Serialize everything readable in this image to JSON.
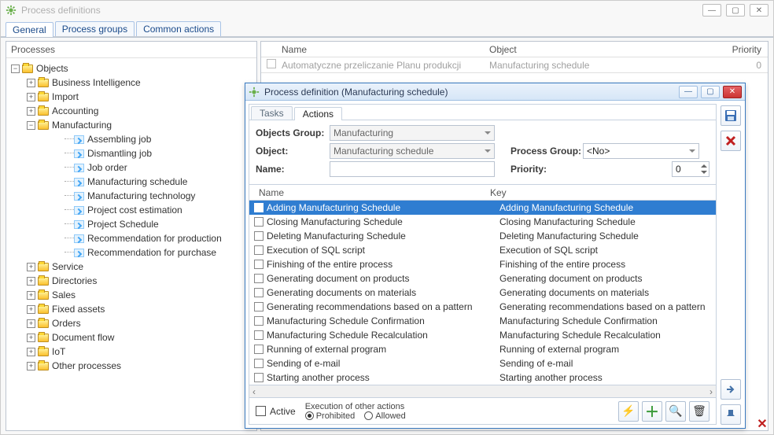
{
  "window": {
    "title": "Process definitions",
    "tabs": [
      "General",
      "Process groups",
      "Common actions"
    ],
    "active_tab": 0
  },
  "tree": {
    "header": "Processes",
    "root": "Objects",
    "folders": [
      {
        "label": "Business Intelligence",
        "expanded": false
      },
      {
        "label": "Import",
        "expanded": false
      },
      {
        "label": "Accounting",
        "expanded": false
      },
      {
        "label": "Manufacturing",
        "expanded": true,
        "children": [
          "Assembling job",
          "Dismantling job",
          "Job order",
          "Manufacturing schedule",
          "Manufacturing technology",
          "Project cost estimation",
          "Project Schedule",
          "Recommendation for production",
          "Recommendation for purchase"
        ]
      },
      {
        "label": "Service",
        "expanded": false
      },
      {
        "label": "Directories",
        "expanded": false
      },
      {
        "label": "Sales",
        "expanded": false
      },
      {
        "label": "Fixed assets",
        "expanded": false
      },
      {
        "label": "Orders",
        "expanded": false
      },
      {
        "label": "Document flow",
        "expanded": false
      },
      {
        "label": "IoT",
        "expanded": false
      },
      {
        "label": "Other processes",
        "expanded": false
      }
    ]
  },
  "main_table": {
    "headers": {
      "name": "Name",
      "object": "Object",
      "priority": "Priority"
    },
    "rows": [
      {
        "name": "Automatyczne przeliczanie Planu produkcji",
        "object": "Manufacturing schedule",
        "priority": "0"
      }
    ]
  },
  "inner": {
    "title": "Process definition (Manufacturing schedule)",
    "tabs": [
      "Tasks",
      "Actions"
    ],
    "active_tab": 1,
    "form": {
      "labels": {
        "objects_group": "Objects Group:",
        "object": "Object:",
        "name": "Name:",
        "process_group": "Process Group:",
        "priority": "Priority:"
      },
      "values": {
        "objects_group": "Manufacturing",
        "object": "Manufacturing schedule",
        "name": "",
        "process_group": "<No>",
        "priority": "0"
      }
    },
    "grid": {
      "headers": {
        "name": "Name",
        "key": "Key"
      },
      "rows": [
        {
          "name": "Adding Manufacturing Schedule",
          "key": "Adding Manufacturing Schedule",
          "sel": true
        },
        {
          "name": "Closing Manufacturing Schedule",
          "key": "Closing Manufacturing Schedule"
        },
        {
          "name": "Deleting Manufacturing Schedule",
          "key": "Deleting Manufacturing Schedule"
        },
        {
          "name": "Execution of SQL script",
          "key": "Execution of SQL script"
        },
        {
          "name": "Finishing of the entire process",
          "key": "Finishing of the entire process"
        },
        {
          "name": "Generating document on products",
          "key": "Generating document on products"
        },
        {
          "name": "Generating documents on materials",
          "key": "Generating documents on materials"
        },
        {
          "name": "Generating recommendations based on a pattern",
          "key": "Generating recommendations based on a pattern"
        },
        {
          "name": "Manufacturing Schedule Confirmation",
          "key": "Manufacturing Schedule Confirmation"
        },
        {
          "name": "Manufacturing Schedule Recalculation",
          "key": "Manufacturing Schedule Recalculation"
        },
        {
          "name": "Running of external program",
          "key": "Running of external program"
        },
        {
          "name": "Sending of e-mail",
          "key": "Sending of e-mail"
        },
        {
          "name": "Starting another process",
          "key": "Starting another process"
        }
      ]
    },
    "footer": {
      "active_label": "Active",
      "exec_label": "Execution of other actions",
      "prohibited": "Prohibited",
      "allowed": "Allowed",
      "selected": "prohibited"
    }
  }
}
